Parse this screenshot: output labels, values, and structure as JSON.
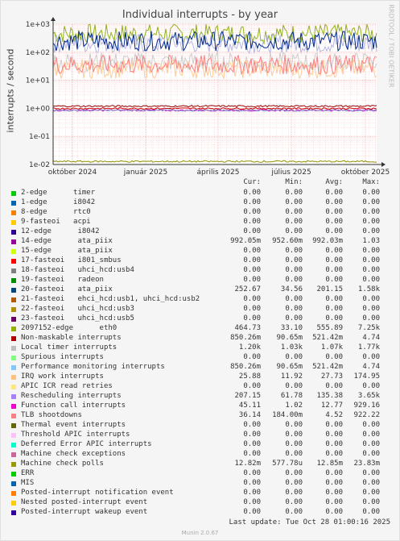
{
  "header": {
    "title": "Individual interrupts - by year",
    "side_label": "RRDTOOL / TOBI OETIKER"
  },
  "chart_data": {
    "type": "line",
    "title": "Individual interrupts - by year",
    "ylabel": "interrupts / second",
    "yscale": "log",
    "ylim": [
      0.01,
      1000
    ],
    "yticks": [
      "1e-02",
      "1e-01",
      "1e+00",
      "1e+01",
      "1e+02",
      "1e+03"
    ],
    "xticks": [
      "október 2024",
      "január 2025",
      "április 2025",
      "július 2025",
      "október 2025"
    ],
    "grid": true,
    "series": [
      {
        "name": "2097152-edge eth0",
        "color": "#8fb21c",
        "level": 464
      },
      {
        "name": "Rescheduling interrupts",
        "color": "#b7b7e4",
        "level": 207
      },
      {
        "name": "20-fasteoi ata_piix",
        "color": "#002a8f",
        "level": 252
      },
      {
        "name": "Function call interrupts",
        "color": "#cccccc",
        "level": 45
      },
      {
        "name": "IRQ work interrupts",
        "color": "#ffcc99",
        "level": 25.88
      },
      {
        "name": "Non-maskable interrupts",
        "color": "#cc00cc",
        "level": 0.85
      },
      {
        "name": "TLB shootdowns",
        "color": "#ff8080",
        "level": 36
      },
      {
        "name": "Local timer interrupts",
        "color": "#990000",
        "level": 1.2
      },
      {
        "name": "14-edge ata_piix",
        "color": "#cc0000",
        "level": 0.99
      },
      {
        "name": "Performance monitoring interrupts",
        "color": "#7f9fcf",
        "level": 0.85
      },
      {
        "name": "Machine check polls",
        "color": "#8f8f00",
        "level": 0.0128
      }
    ]
  },
  "legend_header": {
    "cur": "Cur:",
    "min": "Min:",
    "avg": "Avg:",
    "max": "Max:"
  },
  "legend": [
    {
      "name": "2-edge      timer",
      "color": "#00cc00",
      "cur": "0.00",
      "min": "0.00",
      "avg": "0.00",
      "max": "0.00"
    },
    {
      "name": "1-edge      i8042",
      "color": "#0066b3",
      "cur": "0.00",
      "min": "0.00",
      "avg": "0.00",
      "max": "0.00"
    },
    {
      "name": "8-edge      rtc0",
      "color": "#ff8000",
      "cur": "0.00",
      "min": "0.00",
      "avg": "0.00",
      "max": "0.00"
    },
    {
      "name": "9-fasteoi   acpi",
      "color": "#ffcc00",
      "cur": "0.00",
      "min": "0.00",
      "avg": "0.00",
      "max": "0.00"
    },
    {
      "name": "12-edge      i8042",
      "color": "#330099",
      "cur": "0.00",
      "min": "0.00",
      "avg": "0.00",
      "max": "0.00"
    },
    {
      "name": "14-edge      ata_piix",
      "color": "#990099",
      "cur": "992.05m",
      "min": "952.60m",
      "avg": "992.03m",
      "max": "1.03"
    },
    {
      "name": "15-edge      ata_piix",
      "color": "#ccff00",
      "cur": "0.00",
      "min": "0.00",
      "avg": "0.00",
      "max": "0.00"
    },
    {
      "name": "17-fasteoi   i801_smbus",
      "color": "#ff0000",
      "cur": "0.00",
      "min": "0.00",
      "avg": "0.00",
      "max": "0.00"
    },
    {
      "name": "18-fasteoi   uhci_hcd:usb4",
      "color": "#808080",
      "cur": "0.00",
      "min": "0.00",
      "avg": "0.00",
      "max": "0.00"
    },
    {
      "name": "19-fasteoi   radeon",
      "color": "#008f00",
      "cur": "0.00",
      "min": "0.00",
      "avg": "0.00",
      "max": "0.00"
    },
    {
      "name": "20-fasteoi   ata_piix",
      "color": "#00487d",
      "cur": "252.67",
      "min": "34.56",
      "avg": "201.15",
      "max": "1.58k"
    },
    {
      "name": "21-fasteoi   ehci_hcd:usb1, uhci_hcd:usb2",
      "color": "#b35a00",
      "cur": "0.00",
      "min": "0.00",
      "avg": "0.00",
      "max": "0.00"
    },
    {
      "name": "22-fasteoi   uhci_hcd:usb3",
      "color": "#b38f00",
      "cur": "0.00",
      "min": "0.00",
      "avg": "0.00",
      "max": "0.00"
    },
    {
      "name": "23-fasteoi   uhci_hcd:usb5",
      "color": "#6b006b",
      "cur": "0.00",
      "min": "0.00",
      "avg": "0.00",
      "max": "0.00"
    },
    {
      "name": "2097152-edge      eth0",
      "color": "#8fb300",
      "cur": "464.73",
      "min": "33.10",
      "avg": "555.89",
      "max": "7.25k"
    },
    {
      "name": "Non-maskable interrupts",
      "color": "#b30000",
      "cur": "850.26m",
      "min": "90.65m",
      "avg": "521.42m",
      "max": "4.74"
    },
    {
      "name": "Local timer interrupts",
      "color": "#bebebe",
      "cur": "1.20k",
      "min": "1.03k",
      "avg": "1.07k",
      "max": "1.77k"
    },
    {
      "name": "Spurious interrupts",
      "color": "#80ff80",
      "cur": "0.00",
      "min": "0.00",
      "avg": "0.00",
      "max": "0.00"
    },
    {
      "name": "Performance monitoring interrupts",
      "color": "#80c9ff",
      "cur": "850.26m",
      "min": "90.65m",
      "avg": "521.42m",
      "max": "4.74"
    },
    {
      "name": "IRQ work interrupts",
      "color": "#ffc080",
      "cur": "25.88",
      "min": "11.92",
      "avg": "27.73",
      "max": "174.95"
    },
    {
      "name": "APIC ICR read retries",
      "color": "#ffe680",
      "cur": "0.00",
      "min": "0.00",
      "avg": "0.00",
      "max": "0.00"
    },
    {
      "name": "Rescheduling interrupts",
      "color": "#aa80ff",
      "cur": "207.15",
      "min": "61.78",
      "avg": "135.38",
      "max": "3.65k"
    },
    {
      "name": "Function call interrupts",
      "color": "#ee00cc",
      "cur": "45.11",
      "min": "1.02",
      "avg": "12.77",
      "max": "929.16"
    },
    {
      "name": "TLB shootdowns",
      "color": "#ff8080",
      "cur": "36.14",
      "min": "184.00m",
      "avg": "4.52",
      "max": "922.22"
    },
    {
      "name": "Thermal event interrupts",
      "color": "#666600",
      "cur": "0.00",
      "min": "0.00",
      "avg": "0.00",
      "max": "0.00"
    },
    {
      "name": "Threshold APIC interrupts",
      "color": "#ffbfff",
      "cur": "0.00",
      "min": "0.00",
      "avg": "0.00",
      "max": "0.00"
    },
    {
      "name": "Deferred Error APIC interrupts",
      "color": "#00ffcc",
      "cur": "0.00",
      "min": "0.00",
      "avg": "0.00",
      "max": "0.00"
    },
    {
      "name": "Machine check exceptions",
      "color": "#cc6699",
      "cur": "0.00",
      "min": "0.00",
      "avg": "0.00",
      "max": "0.00"
    },
    {
      "name": "Machine check polls",
      "color": "#999900",
      "cur": "12.82m",
      "min": "577.78u",
      "avg": "12.85m",
      "max": "23.83m"
    },
    {
      "name": "ERR",
      "color": "#00cc00",
      "cur": "0.00",
      "min": "0.00",
      "avg": "0.00",
      "max": "0.00"
    },
    {
      "name": "MIS",
      "color": "#0066b3",
      "cur": "0.00",
      "min": "0.00",
      "avg": "0.00",
      "max": "0.00"
    },
    {
      "name": "Posted-interrupt notification event",
      "color": "#ff8000",
      "cur": "0.00",
      "min": "0.00",
      "avg": "0.00",
      "max": "0.00"
    },
    {
      "name": "Nested posted-interrupt event",
      "color": "#ffcc00",
      "cur": "0.00",
      "min": "0.00",
      "avg": "0.00",
      "max": "0.00"
    },
    {
      "name": "Posted-interrupt wakeup event",
      "color": "#330099",
      "cur": "0.00",
      "min": "0.00",
      "avg": "0.00",
      "max": "0.00"
    }
  ],
  "footer": {
    "last_update": "Last update: Tue Oct 28 01:00:16 2025",
    "munin": "Munin 2.0.67"
  }
}
